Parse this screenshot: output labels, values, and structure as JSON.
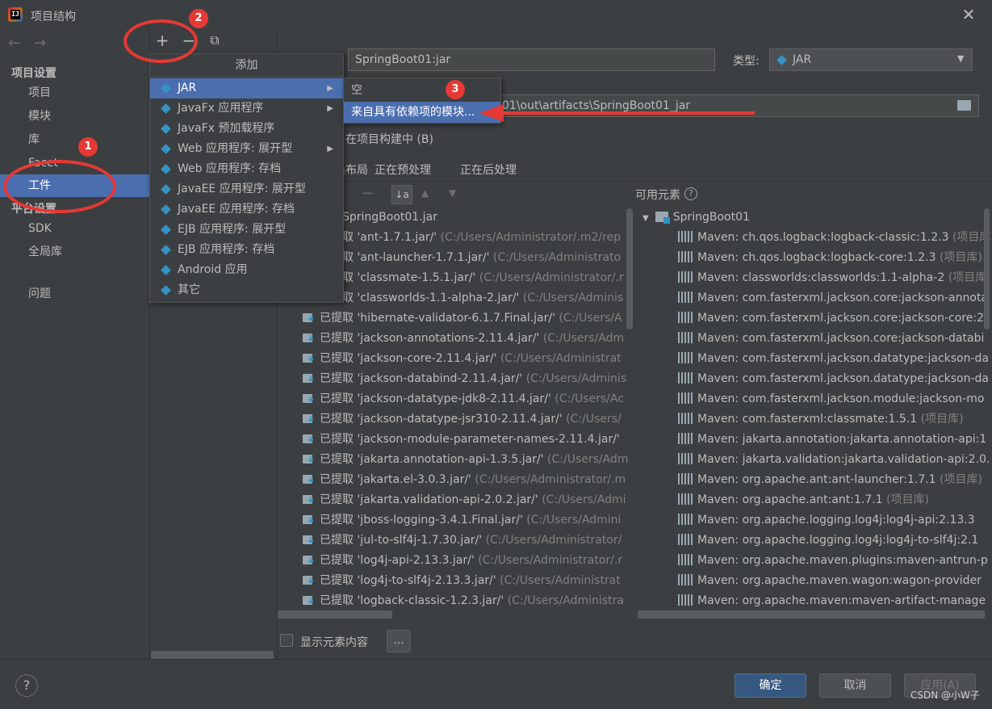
{
  "window": {
    "title": "项目结构",
    "close_glyph": "✕"
  },
  "nav": {
    "back": "←",
    "forward": "→"
  },
  "sidebar": {
    "project_settings_header": "项目设置",
    "items": [
      {
        "label": "项目"
      },
      {
        "label": "模块"
      },
      {
        "label": "库"
      },
      {
        "label": "Facet"
      },
      {
        "label": "工件",
        "selected": true
      }
    ],
    "platform_header": "平台设置",
    "platform_items": [
      {
        "label": "SDK"
      },
      {
        "label": "全局库"
      }
    ],
    "problems": "问题"
  },
  "toolbar": {
    "add": "+",
    "remove": "−",
    "copy": "⧉"
  },
  "artifact": {
    "name": "SpringBoot01:jar",
    "type_label": "类型:",
    "type_value": "JAR",
    "output_path": "01\\out\\artifacts\\SpringBoot01_jar",
    "build_check_label": "在项目构建中 (B)"
  },
  "tabs": [
    {
      "label": "输出布局"
    },
    {
      "label": "正在预处理"
    },
    {
      "label": "正在后处理"
    }
  ],
  "available_label": "可用元素",
  "output_tree": {
    "root": "SpringBoot01.jar",
    "rows": [
      {
        "prefix": "已提取",
        "name": "'ant-1.7.1.jar/'",
        "path": "(C:/Users/Administrator/.m2/rep"
      },
      {
        "prefix": "已提取",
        "name": "'ant-launcher-1.7.1.jar/'",
        "path": "(C:/Users/Administrato"
      },
      {
        "prefix": "已提取",
        "name": "'classmate-1.5.1.jar/'",
        "path": "(C:/Users/Administrator/.r"
      },
      {
        "prefix": "已提取",
        "name": "'classworlds-1.1-alpha-2.jar/'",
        "path": "(C:/Users/Adminis"
      },
      {
        "prefix": "已提取",
        "name": "'hibernate-validator-6.1.7.Final.jar/'",
        "path": "(C:/Users/A"
      },
      {
        "prefix": "已提取",
        "name": "'jackson-annotations-2.11.4.jar/'",
        "path": "(C:/Users/Adm"
      },
      {
        "prefix": "已提取",
        "name": "'jackson-core-2.11.4.jar/'",
        "path": "(C:/Users/Administrat"
      },
      {
        "prefix": "已提取",
        "name": "'jackson-databind-2.11.4.jar/'",
        "path": "(C:/Users/Adminis"
      },
      {
        "prefix": "已提取",
        "name": "'jackson-datatype-jdk8-2.11.4.jar/'",
        "path": "(C:/Users/Ac"
      },
      {
        "prefix": "已提取",
        "name": "'jackson-datatype-jsr310-2.11.4.jar/'",
        "path": "(C:/Users/"
      },
      {
        "prefix": "已提取",
        "name": "'jackson-module-parameter-names-2.11.4.jar/'",
        "path": ""
      },
      {
        "prefix": "已提取",
        "name": "'jakarta.annotation-api-1.3.5.jar/'",
        "path": "(C:/Users/Adm"
      },
      {
        "prefix": "已提取",
        "name": "'jakarta.el-3.0.3.jar/'",
        "path": "(C:/Users/Administrator/.m"
      },
      {
        "prefix": "已提取",
        "name": "'jakarta.validation-api-2.0.2.jar/'",
        "path": "(C:/Users/Admi"
      },
      {
        "prefix": "已提取",
        "name": "'jboss-logging-3.4.1.Final.jar/'",
        "path": "(C:/Users/Admini"
      },
      {
        "prefix": "已提取",
        "name": "'jul-to-slf4j-1.7.30.jar/'",
        "path": "(C:/Users/Administrator/"
      },
      {
        "prefix": "已提取",
        "name": "'log4j-api-2.13.3.jar/'",
        "path": "(C:/Users/Administrator/.r"
      },
      {
        "prefix": "已提取",
        "name": "'log4j-to-slf4j-2.13.3.jar/'",
        "path": "(C:/Users/Administrat"
      },
      {
        "prefix": "已提取",
        "name": "'logback-classic-1.2.3.jar/'",
        "path": "(C:/Users/Administra"
      }
    ]
  },
  "available_tree": {
    "root": "SpringBoot01",
    "rows": [
      {
        "name": "Maven: ch.qos.logback:logback-classic:1.2.3",
        "suffix": "(项目库"
      },
      {
        "name": "Maven: ch.qos.logback:logback-core:1.2.3",
        "suffix": "(项目库)"
      },
      {
        "name": "Maven: classworlds:classworlds:1.1-alpha-2",
        "suffix": "(项目库"
      },
      {
        "name": "Maven: com.fasterxml.jackson.core:jackson-annota",
        "suffix": ""
      },
      {
        "name": "Maven: com.fasterxml.jackson.core:jackson-core:2",
        "suffix": ""
      },
      {
        "name": "Maven: com.fasterxml.jackson.core:jackson-databi",
        "suffix": ""
      },
      {
        "name": "Maven: com.fasterxml.jackson.datatype:jackson-da",
        "suffix": ""
      },
      {
        "name": "Maven: com.fasterxml.jackson.datatype:jackson-da",
        "suffix": ""
      },
      {
        "name": "Maven: com.fasterxml.jackson.module:jackson-mo",
        "suffix": ""
      },
      {
        "name": "Maven: com.fasterxml:classmate:1.5.1",
        "suffix": "(项目库)"
      },
      {
        "name": "Maven: jakarta.annotation:jakarta.annotation-api:1",
        "suffix": ""
      },
      {
        "name": "Maven: jakarta.validation:jakarta.validation-api:2.0.",
        "suffix": ""
      },
      {
        "name": "Maven: org.apache.ant:ant-launcher:1.7.1",
        "suffix": "(项目库)"
      },
      {
        "name": "Maven: org.apache.ant:ant:1.7.1",
        "suffix": "(项目库)"
      },
      {
        "name": "Maven: org.apache.logging.log4j:log4j-api:2.13.3",
        "suffix": ""
      },
      {
        "name": "Maven: org.apache.logging.log4j:log4j-to-slf4j:2.1",
        "suffix": ""
      },
      {
        "name": "Maven: org.apache.maven.plugins:maven-antrun-p",
        "suffix": ""
      },
      {
        "name": "Maven: org.apache.maven.wagon:wagon-provider",
        "suffix": ""
      },
      {
        "name": "Maven: org.apache.maven:maven-artifact-manage",
        "suffix": ""
      }
    ]
  },
  "show_contents_label": "显示元素内容",
  "more_button": "...",
  "add_menu": {
    "header": "添加",
    "items": [
      {
        "label": "JAR",
        "submenu": true,
        "selected": true
      },
      {
        "label": "JavaFx 应用程序",
        "submenu": true
      },
      {
        "label": "JavaFx 预加载程序",
        "submenu": false
      },
      {
        "label": "Web 应用程序: 展开型",
        "submenu": true
      },
      {
        "label": "Web 应用程序: 存档",
        "submenu": false
      },
      {
        "label": "JavaEE 应用程序: 展开型",
        "submenu": false
      },
      {
        "label": "JavaEE 应用程序: 存档",
        "submenu": false
      },
      {
        "label": "EJB 应用程序: 展开型",
        "submenu": false
      },
      {
        "label": "EJB 应用程序: 存档",
        "submenu": false
      },
      {
        "label": "Android 应用",
        "submenu": false
      },
      {
        "label": "其它",
        "submenu": false
      }
    ],
    "submenu_items": [
      {
        "label": "空"
      },
      {
        "label": "来自具有依赖项的模块...",
        "selected": true
      }
    ]
  },
  "annotations": {
    "badge1": "1",
    "badge2": "2",
    "badge3": "3",
    "color": "#e53935"
  },
  "buttons": {
    "ok": "确定",
    "cancel": "取消",
    "apply": "应用(A)",
    "help": "?"
  },
  "watermark": "CSDN @小W子",
  "colors": {
    "selection": "#4b6eaf",
    "background": "#3c3f41",
    "primary_button": "#365880"
  }
}
